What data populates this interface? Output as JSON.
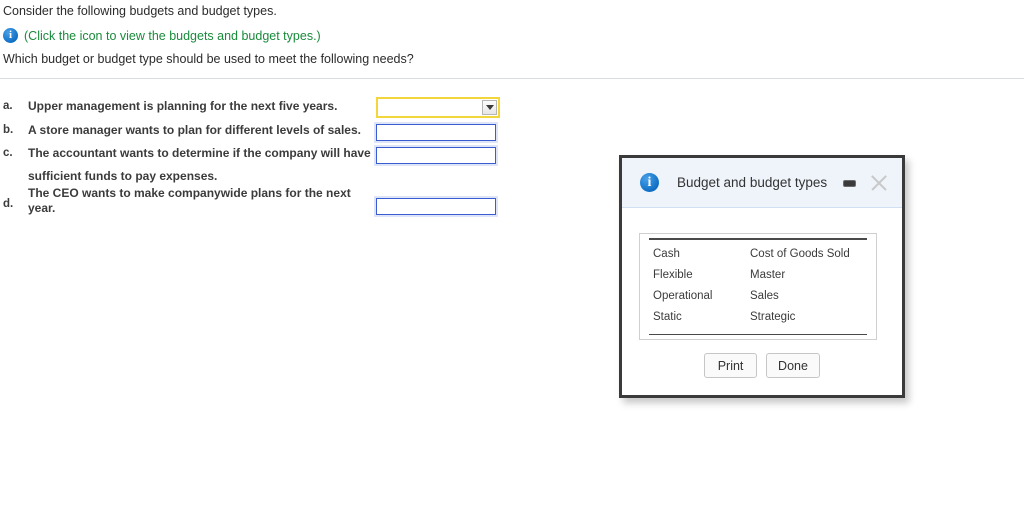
{
  "intro": {
    "line1": "Consider the following budgets and budget types.",
    "hint_icon": "info-icon",
    "hint_text": "(Click the icon to view the budgets and budget types.)",
    "line2": "Which budget or budget type should be used to meet the following needs?"
  },
  "questions": [
    {
      "letter": "a.",
      "text": "Upper management is planning for the next five years.",
      "text_line2": "",
      "field_type": "select",
      "value": "",
      "focused": true
    },
    {
      "letter": "b.",
      "text": "A store manager wants to plan for different levels of sales.",
      "text_line2": "",
      "field_type": "input",
      "value": "",
      "focused": false
    },
    {
      "letter": "c.",
      "text": "The accountant wants to determine if the company will have",
      "text_line2": "sufficient funds to pay expenses.",
      "field_type": "input",
      "value": "",
      "focused": false
    },
    {
      "letter": "d.",
      "text": "The CEO wants to make companywide plans for the next",
      "text_line2": "year.",
      "field_type": "input",
      "value": "",
      "focused": false
    }
  ],
  "dialog": {
    "icon": "info-icon",
    "title": "Budget and budget types",
    "minimize_label": "minimize-icon",
    "close_label": "close-icon",
    "table": {
      "rows": [
        {
          "col1": "Cash",
          "col2": "Cost of Goods Sold"
        },
        {
          "col1": "Flexible",
          "col2": "Master"
        },
        {
          "col1": "Operational",
          "col2": "Sales"
        },
        {
          "col1": "Static",
          "col2": "Strategic"
        }
      ]
    },
    "buttons": {
      "print": "Print",
      "done": "Done"
    }
  },
  "colors": {
    "link_green": "#1a8a3c",
    "info_blue": "#0f6fc5",
    "focus_yellow": "#f2d63c",
    "input_blue": "#3b5bd0",
    "dialog_header": "#eff4fb"
  }
}
